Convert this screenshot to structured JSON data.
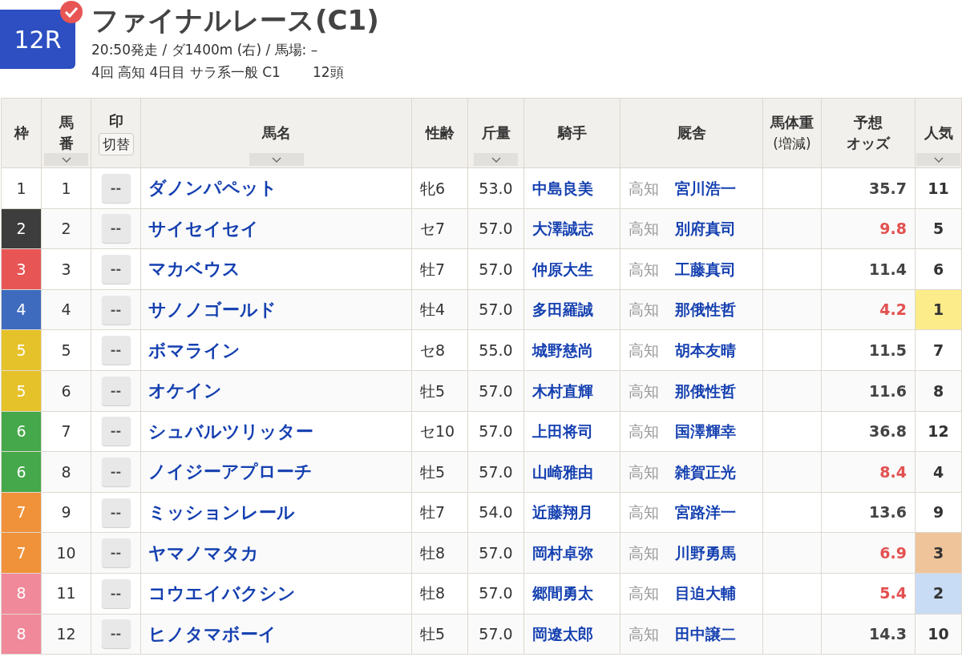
{
  "race": {
    "number": "12R",
    "checked": true,
    "title": "ファイナルレース(C1)",
    "info": "20:50発走 / ダ1400m (右) / 馬場: –",
    "meeting": "4回 高知 4日目 サラ系一般 C1",
    "runners": "12頭"
  },
  "columns": [
    {
      "lines": [
        "枠"
      ],
      "sortable": false
    },
    {
      "lines": [
        "馬",
        "番"
      ],
      "sortable": true
    },
    {
      "lines": [
        "印"
      ],
      "sortable": false,
      "button": "切替"
    },
    {
      "lines": [
        "馬名"
      ],
      "sortable": true
    },
    {
      "lines": [
        "性齢"
      ],
      "sortable": false
    },
    {
      "lines": [
        "斤量"
      ],
      "sortable": true
    },
    {
      "lines": [
        "騎手"
      ],
      "sortable": false
    },
    {
      "lines": [
        "厩舎"
      ],
      "sortable": false
    },
    {
      "lines": [
        "馬体重"
      ],
      "sortable": false,
      "sub": "(増減)"
    },
    {
      "lines": [
        "予想",
        "オッズ"
      ],
      "sortable": false
    },
    {
      "lines": [
        "人気"
      ],
      "sortable": true
    }
  ],
  "rows": [
    {
      "frame": "1",
      "color": "#ffffff",
      "num": "1",
      "mark": "--",
      "name": "ダノンパペット",
      "sexage": "牝6",
      "weight": "53.0",
      "jockey": "中島良美",
      "region": "高知",
      "trainer": "宮川浩一",
      "odds": "35.7",
      "hot": false,
      "pop": "11"
    },
    {
      "frame": "2",
      "color": "#3d3d3d",
      "num": "2",
      "mark": "--",
      "name": "サイセイセイ",
      "sexage": "セ7",
      "weight": "57.0",
      "jockey": "大澤誠志",
      "region": "高知",
      "trainer": "別府真司",
      "odds": "9.8",
      "hot": true,
      "pop": "5"
    },
    {
      "frame": "3",
      "color": "#e85555",
      "num": "3",
      "mark": "--",
      "name": "マカベウス",
      "sexage": "牡7",
      "weight": "57.0",
      "jockey": "仲原大生",
      "region": "高知",
      "trainer": "工藤真司",
      "odds": "11.4",
      "hot": false,
      "pop": "6"
    },
    {
      "frame": "4",
      "color": "#3f6bbf",
      "num": "4",
      "mark": "--",
      "name": "サノノゴールド",
      "sexage": "牡4",
      "weight": "57.0",
      "jockey": "多田羅誠",
      "region": "高知",
      "trainer": "那俄性哲",
      "odds": "4.2",
      "hot": true,
      "pop": "1",
      "pop_badge": {
        "color": "#fdec8a"
      }
    },
    {
      "frame": "5",
      "color": "#e6c22a",
      "num": "5",
      "mark": "--",
      "name": "ボマライン",
      "sexage": "セ8",
      "weight": "55.0",
      "jockey": "城野慈尚",
      "region": "高知",
      "trainer": "胡本友晴",
      "odds": "11.5",
      "hot": false,
      "pop": "7"
    },
    {
      "frame": "5",
      "color": "#e6c22a",
      "num": "6",
      "mark": "--",
      "name": "オケイン",
      "sexage": "牡5",
      "weight": "57.0",
      "jockey": "木村直輝",
      "region": "高知",
      "trainer": "那俄性哲",
      "odds": "11.6",
      "hot": false,
      "pop": "8"
    },
    {
      "frame": "6",
      "color": "#45a84a",
      "num": "7",
      "mark": "--",
      "name": "シュバルツリッター",
      "sexage": "セ10",
      "weight": "57.0",
      "jockey": "上田将司",
      "region": "高知",
      "trainer": "国澤輝幸",
      "odds": "36.8",
      "hot": false,
      "pop": "12"
    },
    {
      "frame": "6",
      "color": "#45a84a",
      "num": "8",
      "mark": "--",
      "name": "ノイジーアプローチ",
      "sexage": "牡5",
      "weight": "57.0",
      "jockey": "山崎雅由",
      "region": "高知",
      "trainer": "雑賀正光",
      "odds": "8.4",
      "hot": true,
      "pop": "4"
    },
    {
      "frame": "7",
      "color": "#f0923a",
      "num": "9",
      "mark": "--",
      "name": "ミッションレール",
      "sexage": "牡7",
      "weight": "54.0",
      "jockey": "近藤翔月",
      "region": "高知",
      "trainer": "宮路洋一",
      "odds": "13.6",
      "hot": false,
      "pop": "9"
    },
    {
      "frame": "7",
      "color": "#f0923a",
      "num": "10",
      "mark": "--",
      "name": "ヤマノマタカ",
      "sexage": "牡8",
      "weight": "57.0",
      "jockey": "岡村卓弥",
      "region": "高知",
      "trainer": "川野勇馬",
      "odds": "6.9",
      "hot": true,
      "pop": "3",
      "pop_badge": {
        "color": "#efc49a"
      }
    },
    {
      "frame": "8",
      "color": "#f0899a",
      "num": "11",
      "mark": "--",
      "name": "コウエイバクシン",
      "sexage": "牡8",
      "weight": "57.0",
      "jockey": "郷間勇太",
      "region": "高知",
      "trainer": "目迫大輔",
      "odds": "5.4",
      "hot": true,
      "pop": "2",
      "pop_badge": {
        "color": "#c9dcf5"
      }
    },
    {
      "frame": "8",
      "color": "#f0899a",
      "num": "12",
      "mark": "--",
      "name": "ヒノタマボーイ",
      "sexage": "牡5",
      "weight": "57.0",
      "jockey": "岡遼太郎",
      "region": "高知",
      "trainer": "田中譲二",
      "odds": "14.3",
      "hot": false,
      "pop": "10"
    }
  ]
}
